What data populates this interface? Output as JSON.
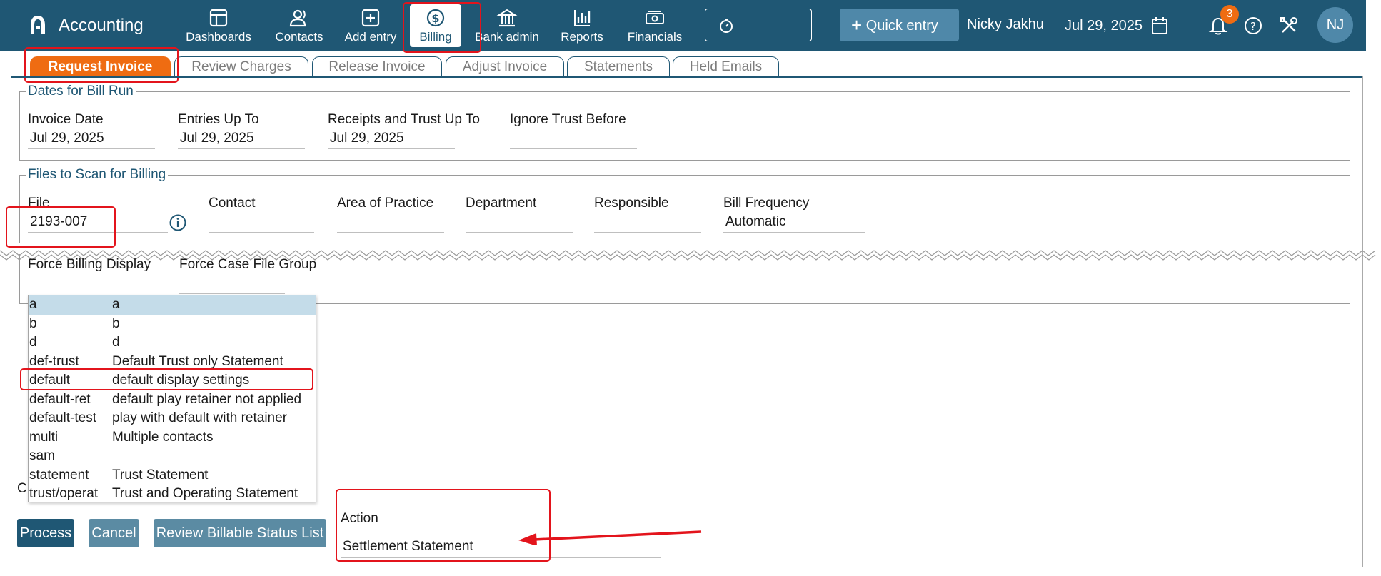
{
  "app": {
    "title": "Accounting"
  },
  "nav": [
    {
      "label": "Dashboards",
      "icon": "dashboard-icon"
    },
    {
      "label": "Contacts",
      "icon": "contacts-icon"
    },
    {
      "label": "Add entry",
      "icon": "add-entry-icon"
    },
    {
      "label": "Billing",
      "icon": "billing-dollar-icon",
      "active": true
    },
    {
      "label": "Bank admin",
      "icon": "bank-icon"
    },
    {
      "label": "Reports",
      "icon": "reports-chart-icon"
    },
    {
      "label": "Financials",
      "icon": "financials-cash-icon"
    }
  ],
  "header": {
    "quick_entry": "Quick entry",
    "user_name": "Nicky Jakhu",
    "date": "Jul 29, 2025",
    "notification_count": "3",
    "avatar_initials": "NJ"
  },
  "tabs": [
    {
      "label": "Request Invoice",
      "active": true
    },
    {
      "label": "Review Charges"
    },
    {
      "label": "Release Invoice"
    },
    {
      "label": "Adjust Invoice"
    },
    {
      "label": "Statements"
    },
    {
      "label": "Held Emails"
    }
  ],
  "dates_group": {
    "legend": "Dates for Bill Run",
    "fields": [
      {
        "label": "Invoice Date",
        "value": "Jul 29, 2025"
      },
      {
        "label": "Entries Up To",
        "value": "Jul 29, 2025"
      },
      {
        "label": "Receipts and Trust Up To",
        "value": "Jul 29, 2025"
      },
      {
        "label": "Ignore Trust Before",
        "value": ""
      }
    ]
  },
  "files_group": {
    "legend": "Files to Scan for Billing",
    "fields": [
      {
        "label": "File",
        "value": "2193-007"
      },
      {
        "label": "Contact",
        "value": ""
      },
      {
        "label": "Area of Practice",
        "value": ""
      },
      {
        "label": "Department",
        "value": ""
      },
      {
        "label": "Responsible",
        "value": ""
      },
      {
        "label": "Bill Frequency",
        "value": "Automatic"
      }
    ]
  },
  "force": {
    "billing_display_label": "Force Billing Display",
    "case_file_group_label": "Force Case File Group"
  },
  "dropdown": {
    "options": [
      {
        "code": "a",
        "desc": "a",
        "highlighted": true
      },
      {
        "code": "b",
        "desc": "b"
      },
      {
        "code": "d",
        "desc": "d"
      },
      {
        "code": "def-trust",
        "desc": "Default Trust only Statement"
      },
      {
        "code": "default",
        "desc": "default display settings"
      },
      {
        "code": "default-ret",
        "desc": "default play retainer not applied"
      },
      {
        "code": "default-test",
        "desc": "play with default with retainer"
      },
      {
        "code": "multi",
        "desc": "Multiple contacts"
      },
      {
        "code": "sam",
        "desc": ""
      },
      {
        "code": "statement",
        "desc": "Trust Statement"
      },
      {
        "code": "trust/operat",
        "desc": "Trust and Operating Statement"
      }
    ]
  },
  "partial_label": "C",
  "buttons": {
    "process": "Process",
    "cancel": "Cancel",
    "review": "Review Billable Status List"
  },
  "action": {
    "label": "Action",
    "value": "Settlement Statement"
  },
  "colors": {
    "primary": "#1f5774",
    "accent": "#ef6c12",
    "annotation_red": "#e3141c",
    "selected_row": "#c4dce9"
  }
}
